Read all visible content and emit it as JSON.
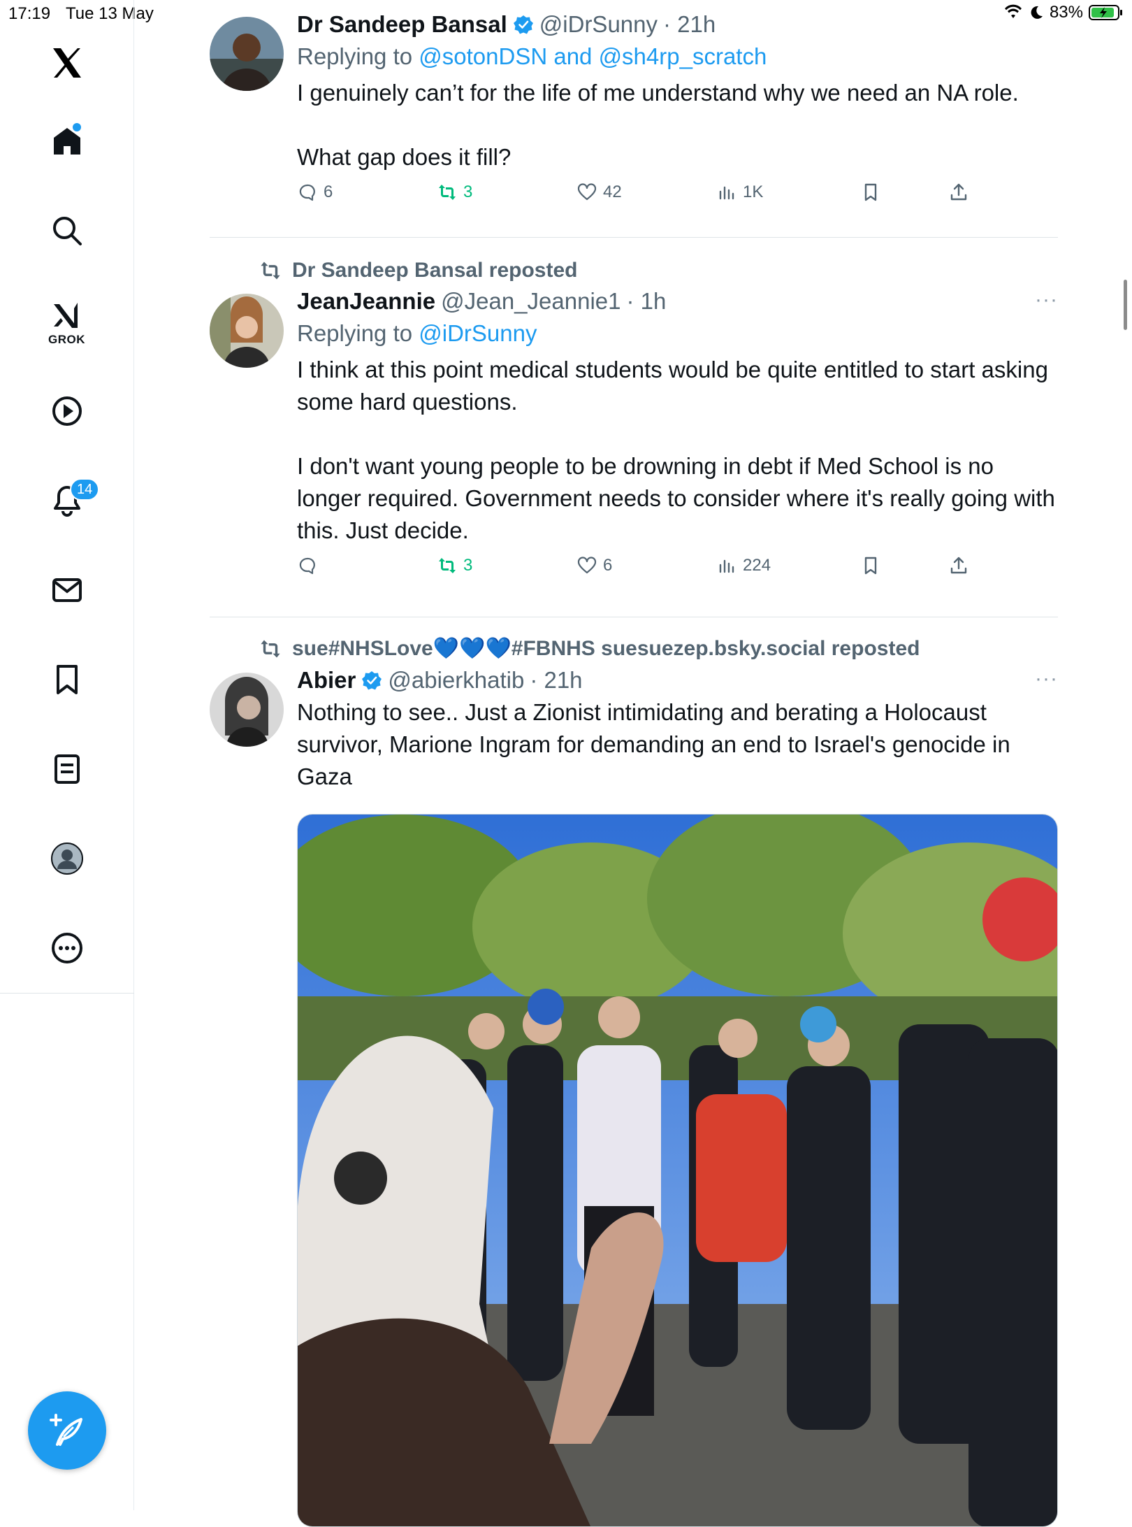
{
  "status": {
    "time": "17:19",
    "date": "Tue 13 May",
    "battery": "83%"
  },
  "sidebar": {
    "grok_label": "GROK",
    "notifications_count": "14"
  },
  "tweets": [
    {
      "name": "Dr Sandeep Bansal",
      "handle": "@iDrSunny",
      "time": "· 21h",
      "verified": true,
      "reply_prefix": "Replying to ",
      "reply_to": "@sotonDSN and @sh4rp_scratch",
      "paragraphs": [
        "I genuinely can’t for the life of me understand why we need an NA role.",
        "What gap does it fill?"
      ],
      "stats": {
        "replies": "6",
        "reposts": "3",
        "likes": "42",
        "views": "1K"
      }
    },
    {
      "repost_by": "Dr Sandeep Bansal reposted",
      "name": "JeanJeannie",
      "handle": "@Jean_Jeannie1",
      "time": "· 1h",
      "more": "···",
      "reply_prefix": "Replying to ",
      "reply_to": "@iDrSunny",
      "paragraphs": [
        "I think at this point medical students would be quite entitled to start asking some hard questions.",
        "I don't want young people to be drowning in debt if Med School is no longer required. Government needs to consider where it's really going with this. Just decide."
      ],
      "stats": {
        "replies": "",
        "reposts": "3",
        "likes": "6",
        "views": "224"
      }
    },
    {
      "repost_by": "sue#NHSLove💙💙💙#FBNHS suesuezep.bsky.social reposted",
      "name": "Abier",
      "handle": "@abierkhatib",
      "time": "· 21h",
      "verified": true,
      "more": "···",
      "paragraphs": [
        "Nothing to see.. Just a Zionist intimidating and berating a Holocaust survivor, Marione Ingram for demanding an end to Israel's genocide in Gaza"
      ]
    }
  ],
  "colors": {
    "accent": "#1d9bf0",
    "repost_green": "#00ba7c",
    "secondary_text": "#536471"
  }
}
